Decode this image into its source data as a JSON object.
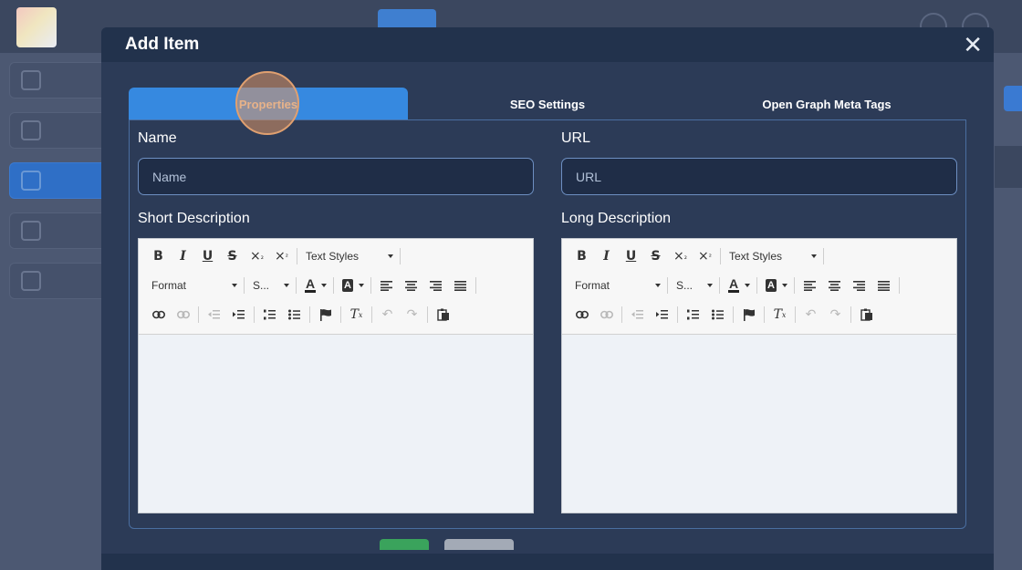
{
  "modal": {
    "title": "Add Item",
    "close_symbol": "✕"
  },
  "tabs": [
    {
      "label": "Properties",
      "active": true
    },
    {
      "label": "SEO Settings",
      "active": false
    },
    {
      "label": "Open Graph Meta Tags",
      "active": false
    }
  ],
  "form": {
    "name_label": "Name",
    "name_placeholder": "Name",
    "url_label": "URL",
    "url_placeholder": "URL",
    "short_desc_label": "Short Description",
    "long_desc_label": "Long Description"
  },
  "editor_toolbar": {
    "bold": "B",
    "italic": "I",
    "underline": "U",
    "strikethrough": "S",
    "text_styles": "Text Styles",
    "format": "Format",
    "size": "S...",
    "font_color": "A",
    "bg_color": "A"
  },
  "icons": [
    "close-icon",
    "bold-icon",
    "italic-icon",
    "underline-icon",
    "strikethrough-icon",
    "subscript-icon",
    "superscript-icon",
    "link-icon",
    "unlink-icon",
    "outdent-icon",
    "indent-icon",
    "numbered-list-icon",
    "bulleted-list-icon",
    "anchor-flag-icon",
    "remove-format-icon",
    "undo-icon",
    "redo-icon",
    "paste-from-word-icon",
    "align-left-icon",
    "align-center-icon",
    "align-right-icon",
    "justify-icon"
  ],
  "colors": {
    "modal_bg": "#2c3b57",
    "header_bg": "#22324c",
    "active_tab": "#3689e0",
    "input_border": "#6d8fc2"
  }
}
